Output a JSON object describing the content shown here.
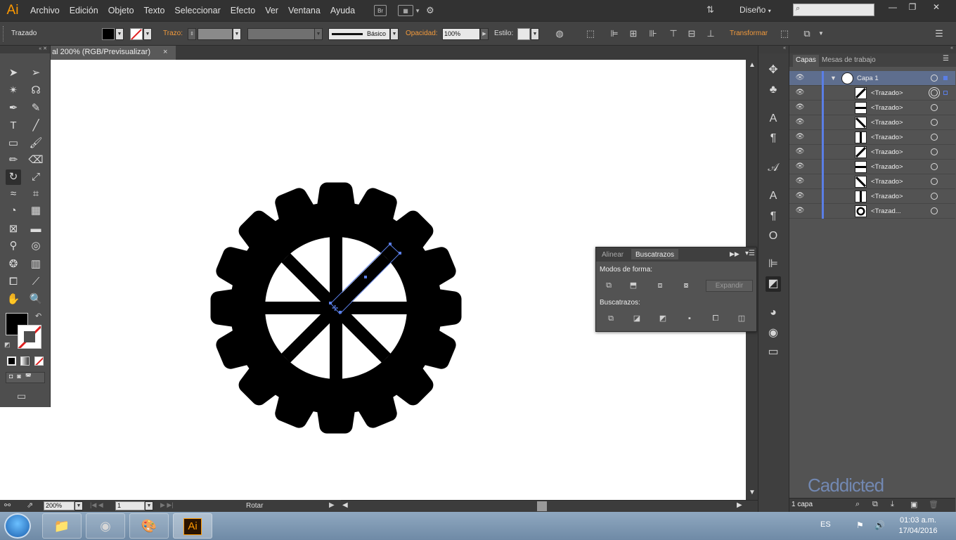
{
  "app": {
    "logo": "Ai"
  },
  "menubar": {
    "items": [
      "Archivo",
      "Edición",
      "Objeto",
      "Texto",
      "Seleccionar",
      "Efecto",
      "Ver",
      "Ventana",
      "Ayuda"
    ],
    "bridge_label": "Br",
    "workspace": "Diseño",
    "search_placeholder": ""
  },
  "controlbar": {
    "selection_label": "Trazado",
    "stroke_label": "Trazo:",
    "brush_label": "Básico",
    "opacity_label": "Opacidad:",
    "opacity_value": "100%",
    "style_label": "Estilo:",
    "transform_label": "Transformar"
  },
  "document": {
    "tab_title": "al 200% (RGB/Previsualizar)",
    "tab_close": "×"
  },
  "statusbar": {
    "zoom": "200%",
    "artboard": "1",
    "tool_status": "Rotar"
  },
  "pathfinder": {
    "tabs": [
      "Alinear",
      "Buscatrazos"
    ],
    "shape_modes_label": "Modos de forma:",
    "pathfinders_label": "Buscatrazos:",
    "expand_label": "Expandir"
  },
  "layers": {
    "tabs": [
      "Capas",
      "Mesas de trabajo"
    ],
    "layer_name": "Capa 1",
    "items": [
      {
        "name": "<Trazado>",
        "thumb": "diag-up"
      },
      {
        "name": "<Trazado>",
        "thumb": "horizontal"
      },
      {
        "name": "<Trazado>",
        "thumb": "diag-down"
      },
      {
        "name": "<Trazado>",
        "thumb": "vertical"
      },
      {
        "name": "<Trazado>",
        "thumb": "diag-up"
      },
      {
        "name": "<Trazado>",
        "thumb": "horizontal"
      },
      {
        "name": "<Trazado>",
        "thumb": "diag-down"
      },
      {
        "name": "<Trazado>",
        "thumb": "vertical"
      },
      {
        "name": "<Trazad...",
        "thumb": "gear"
      }
    ],
    "count_label": "1 capa",
    "watermark": "Caddicted"
  },
  "taskbar": {
    "language": "ES",
    "time": "01:03 a.m.",
    "date": "17/04/2016",
    "ai_label": "Ai"
  },
  "colors": {
    "accent_orange": "#f29a3c",
    "selection_blue": "#5a7ee6",
    "ui_dark": "#323232",
    "ui_mid": "#535353"
  }
}
